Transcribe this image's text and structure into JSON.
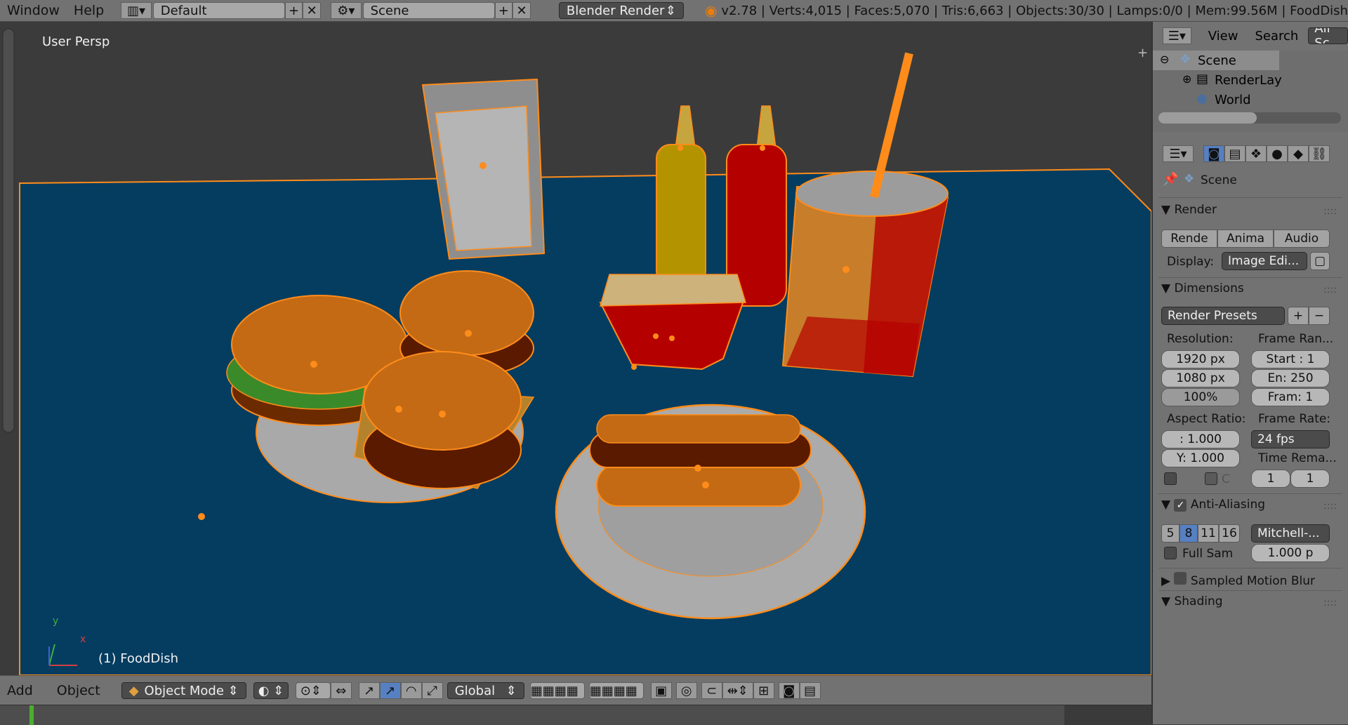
{
  "topbar": {
    "menus": [
      "Window",
      "Help"
    ],
    "layout": "Default",
    "scene": "Scene",
    "engine": "Blender Render",
    "stats": "v2.78 | Verts:4,015 | Faces:5,070 | Tris:6,663 | Objects:30/30 | Lamps:0/0 | Mem:99.56M | FoodDish",
    "add_glyph": "+",
    "close_glyph": "✕"
  },
  "viewport": {
    "view_name": "User Persp",
    "active_object": "(1) FoodDish",
    "axis_y": "y",
    "axis_x": "x"
  },
  "bottombar": {
    "menus": [
      "Add",
      "Object"
    ],
    "mode": "Object Mode",
    "orientation": "Global"
  },
  "outliner": {
    "header": {
      "view": "View",
      "search": "Search",
      "filter": "All Sc"
    },
    "items": [
      "Scene",
      "RenderLay",
      "World"
    ]
  },
  "properties": {
    "context": "Scene",
    "render": {
      "title": "Render",
      "buttons": [
        "Rende",
        "Anima",
        "Audio"
      ],
      "display_label": "Display:",
      "display_value": "Image Edi..."
    },
    "dimensions": {
      "title": "Dimensions",
      "presets": "Render Presets",
      "resolution_label": "Resolution:",
      "res_x": "1920 px",
      "res_y": "1080 px",
      "res_pct": "100%",
      "frame_range_label": "Frame Ran...",
      "start": "Start : 1",
      "end": "En: 250",
      "frame": "Fram: 1",
      "aspect_label": "Aspect Ratio:",
      "aspect_x": ": 1.000",
      "aspect_y": "Y: 1.000",
      "frame_rate_label": "Frame Rate:",
      "fps": "24 fps",
      "time_label": "Time Rema...",
      "time_old": "1",
      "time_new": "1",
      "crop_label": "C"
    },
    "anti_aliasing": {
      "title": "Anti-Aliasing",
      "samples": [
        "5",
        "8",
        "11",
        "16"
      ],
      "selected_sample": "8",
      "filter": "Mitchell-...",
      "full_sample": "Full Sam",
      "size": "1.000 p"
    },
    "motion_blur": {
      "title": "Sampled Motion Blur"
    },
    "shading": {
      "title": "Shading"
    }
  },
  "colors": {
    "ui_gray": "#727272",
    "viewport_bg": "#3b3b3b",
    "table_blue": "#053d61",
    "selection_orange": "#ff8c1a",
    "accent_blue": "#5680c2"
  }
}
